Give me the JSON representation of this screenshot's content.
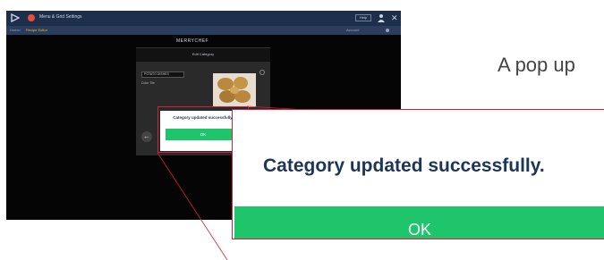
{
  "caption": "A pop up",
  "app": {
    "title": "Menu & Grid Settings",
    "help_label": "Help",
    "breadcrumb": {
      "home": "Home",
      "separator": "›",
      "current": "Recipe Editor",
      "right_text": "Account"
    },
    "brand": "MERRYCHEF",
    "dialog": {
      "header": "Edit Category",
      "name_value": "POTATO DISHES",
      "color_label": "Color Tile",
      "photo_caption": "Select Photo"
    }
  },
  "popup": {
    "message": "Category updated successfully.",
    "ok_label": "OK"
  },
  "colors": {
    "ok_green": "#1fc56a",
    "highlight_red": "#d31f3a",
    "message_navy": "#1d3557",
    "titlebar_navy": "#1d2f4b"
  }
}
